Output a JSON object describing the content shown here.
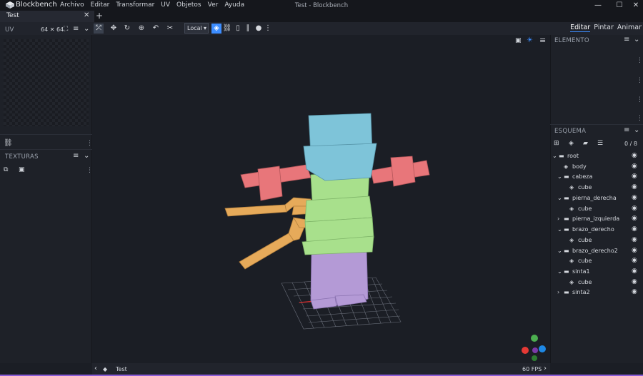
{
  "app": {
    "name": "Blockbench",
    "window_title": "Test - Blockbench",
    "menu": [
      "Archivo",
      "Editar",
      "Transformar",
      "UV",
      "Objetos",
      "Ver",
      "Ayuda"
    ]
  },
  "tabs": [
    {
      "label": "Test"
    }
  ],
  "toolbar": {
    "space_select": "Local",
    "modes": [
      "Editar",
      "Pintar",
      "Animar"
    ],
    "active_mode": "Editar"
  },
  "left_panel": {
    "uv": {
      "title": "UV",
      "size": "64 ✕ 64"
    },
    "textures": {
      "title": "TEXTURAS"
    }
  },
  "right_panel": {
    "element": {
      "title": "ELEMENTO"
    },
    "outliner": {
      "title": "ESQUEMA",
      "count": "0 / 8",
      "items": [
        {
          "label": "root",
          "type": "folder",
          "expanded": true
        },
        {
          "label": "body",
          "type": "cube"
        },
        {
          "label": "cabeza",
          "type": "folder",
          "expanded": true
        },
        {
          "label": "cube",
          "type": "cube"
        },
        {
          "label": "pierna_derecha",
          "type": "folder",
          "expanded": true
        },
        {
          "label": "cube",
          "type": "cube"
        },
        {
          "label": "pierna_izquierda",
          "type": "folder",
          "expanded": false
        },
        {
          "label": "brazo_derecho",
          "type": "folder",
          "expanded": true
        },
        {
          "label": "cube",
          "type": "cube"
        },
        {
          "label": "brazo_derecho2",
          "type": "folder",
          "expanded": true
        },
        {
          "label": "cube",
          "type": "cube"
        },
        {
          "label": "sinta1",
          "type": "folder",
          "expanded": true
        },
        {
          "label": "cube",
          "type": "cube"
        },
        {
          "label": "sinta2",
          "type": "folder",
          "expanded": false
        }
      ]
    }
  },
  "status": {
    "project": "Test",
    "fps": "60 FPS"
  },
  "colors": {
    "accent": "#3c8dff",
    "head": "#7ec4d9",
    "arms": "#e8767a",
    "body": "#a8e08c",
    "legs": "#b49ad6",
    "ribbons": "#e6aa5a"
  }
}
